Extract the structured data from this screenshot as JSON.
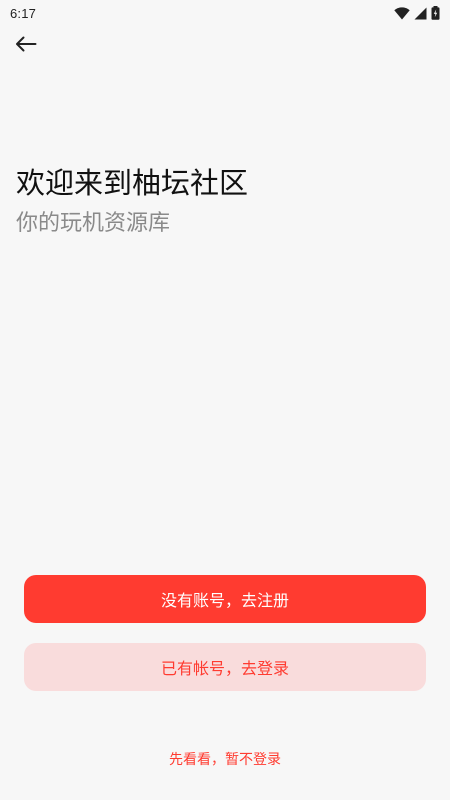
{
  "status_bar": {
    "time": "6:17",
    "icons": [
      "wifi-icon",
      "cellular-signal-icon",
      "battery-icon"
    ]
  },
  "header": {
    "back_icon": "arrow-left-icon"
  },
  "welcome": {
    "title": "欢迎来到柚坛社区",
    "subtitle": "你的玩机资源库"
  },
  "actions": {
    "register_label": "没有账号，去注册",
    "login_label": "已有帐号，去登录",
    "skip_label": "先看看，暂不登录"
  },
  "colors": {
    "accent": "#ff3b30",
    "accent_light": "#f9dcdc",
    "background": "#f7f7f7",
    "title_text": "#111111",
    "subtitle_text": "#8a8a8a"
  }
}
